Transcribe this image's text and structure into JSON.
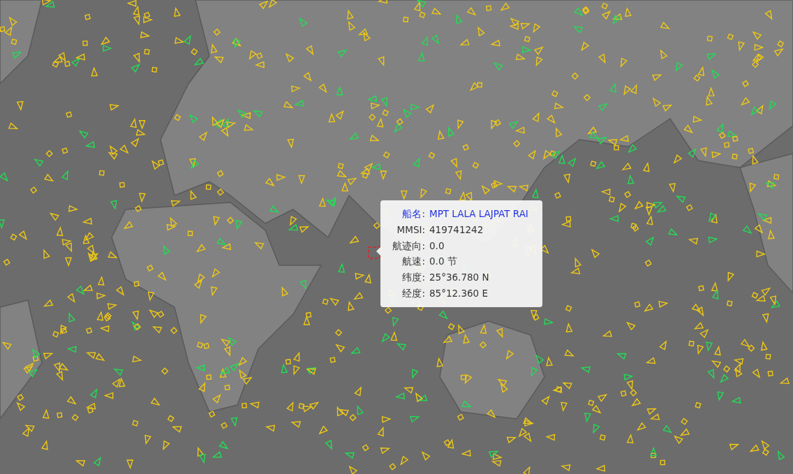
{
  "tooltip": {
    "rows": [
      {
        "kind": "name",
        "label": "船名:",
        "value": "MPT LALA LAJPAT RAI"
      },
      {
        "kind": "field",
        "label": "MMSI:",
        "value": "419741242"
      },
      {
        "kind": "field",
        "label": "航迹向:",
        "value": "0.0"
      },
      {
        "kind": "field",
        "label": "航速:",
        "value": "0.0 节"
      },
      {
        "kind": "field",
        "label": "纬度:",
        "value": "25°36.780 N"
      },
      {
        "kind": "field",
        "label": "经度:",
        "value": "85°12.360 E"
      }
    ]
  }
}
